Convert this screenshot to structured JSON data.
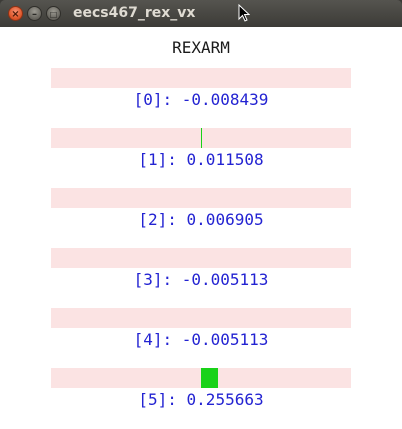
{
  "window": {
    "title": "eecs467_rex_vx",
    "close_glyph": "×",
    "minimize_glyph": "–",
    "maximize_glyph": "□"
  },
  "app": {
    "title": "REXARM"
  },
  "joints": [
    {
      "label": "[0]: -0.008439",
      "value": -0.008439
    },
    {
      "label": "[1]: 0.011508",
      "value": 0.011508
    },
    {
      "label": "[2]: 0.006905",
      "value": 0.006905
    },
    {
      "label": "[3]: -0.005113",
      "value": -0.005113
    },
    {
      "label": "[4]: -0.005113",
      "value": -0.005113
    },
    {
      "label": "[5]: 0.255663",
      "value": 0.255663
    }
  ],
  "colors": {
    "bar_background": "#fbe3e3",
    "marker": "#19d219",
    "label_text": "#2323d2"
  }
}
